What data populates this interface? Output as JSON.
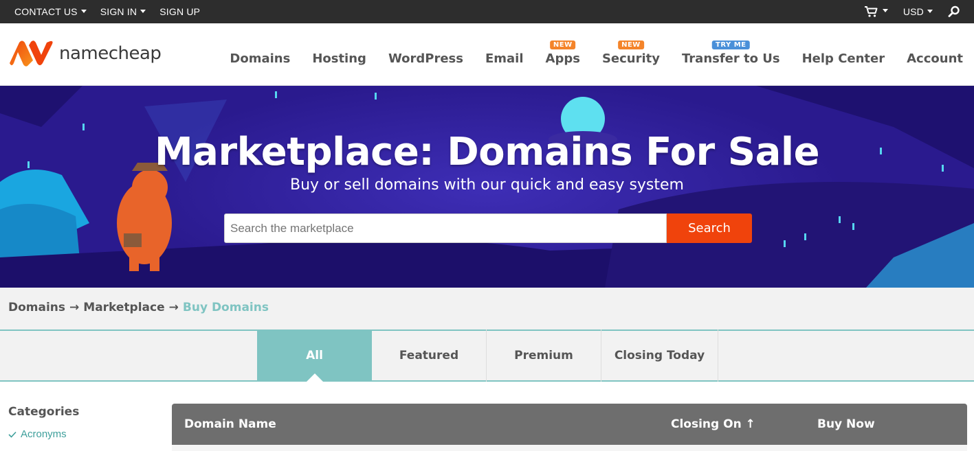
{
  "topbar": {
    "contact": "CONTACT US",
    "signin": "SIGN IN",
    "signup": "SIGN UP",
    "currency": "USD"
  },
  "brand": {
    "name": "namecheap",
    "accent": "#f0430c"
  },
  "nav": [
    {
      "label": "Domains",
      "badge": ""
    },
    {
      "label": "Hosting",
      "badge": ""
    },
    {
      "label": "WordPress",
      "badge": ""
    },
    {
      "label": "Email",
      "badge": ""
    },
    {
      "label": "Apps",
      "badge": "NEW"
    },
    {
      "label": "Security",
      "badge": "NEW"
    },
    {
      "label": "Transfer to Us",
      "badge": "TRY ME"
    },
    {
      "label": "Help Center",
      "badge": ""
    },
    {
      "label": "Account",
      "badge": ""
    }
  ],
  "hero": {
    "title": "Marketplace: Domains For Sale",
    "subtitle": "Buy or sell domains with our quick and easy system",
    "search_placeholder": "Search the marketplace",
    "search_button": "Search"
  },
  "breadcrumb": {
    "items": [
      "Domains",
      "Marketplace"
    ],
    "separator": "→",
    "current": "Buy Domains"
  },
  "tabs": [
    "All",
    "Featured",
    "Premium",
    "Closing Today"
  ],
  "sidebar": {
    "heading": "Categories",
    "items": [
      "Acronyms"
    ]
  },
  "table": {
    "columns": [
      "Domain Name",
      "Closing On ↑",
      "Buy Now"
    ]
  },
  "colors": {
    "topbar": "#2d2d2d",
    "hero": "#2a1a8e",
    "teal": "#7fc4c2",
    "badge_orange": "#f4842a",
    "badge_blue": "#4a90d9"
  }
}
